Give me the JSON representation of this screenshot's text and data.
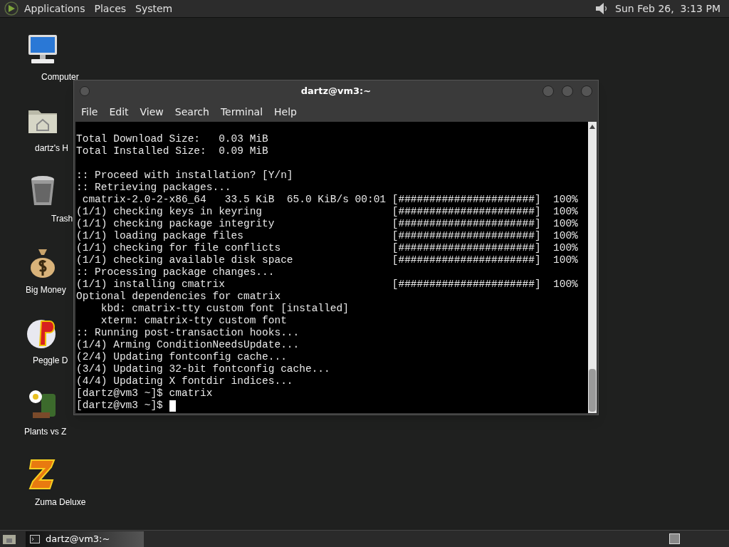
{
  "top_panel": {
    "menus": [
      "Applications",
      "Places",
      "System"
    ],
    "clock": "Sun Feb 26,  3:13 PM"
  },
  "desktop_icons": [
    {
      "kind": "computer",
      "label": "Computer"
    },
    {
      "kind": "home",
      "label": "dartz's H"
    },
    {
      "kind": "trash",
      "label": "Trash"
    },
    {
      "kind": "money",
      "label": "Big Money"
    },
    {
      "kind": "peggle",
      "label": "Peggle D"
    },
    {
      "kind": "plants",
      "label": "Plants vs Z"
    },
    {
      "kind": "zuma",
      "label": "Zuma Deluxe"
    }
  ],
  "window": {
    "title": "dartz@vm3:~",
    "menu": [
      "File",
      "Edit",
      "View",
      "Search",
      "Terminal",
      "Help"
    ],
    "lines": [
      {
        "kind": "text",
        "text": "Total Download Size:   0.03 MiB"
      },
      {
        "kind": "text",
        "text": "Total Installed Size:  0.09 MiB"
      },
      {
        "kind": "blank"
      },
      {
        "kind": "text",
        "text": ":: Proceed with installation? [Y/n]"
      },
      {
        "kind": "text",
        "text": ":: Retrieving packages..."
      },
      {
        "kind": "progress",
        "text": " cmatrix-2.0-2-x86_64   33.5 KiB  65.0 KiB/s 00:01",
        "bar": "[######################]",
        "percent": "100%"
      },
      {
        "kind": "progress",
        "text": "(1/1) checking keys in keyring",
        "bar": "[######################]",
        "percent": "100%"
      },
      {
        "kind": "progress",
        "text": "(1/1) checking package integrity",
        "bar": "[######################]",
        "percent": "100%"
      },
      {
        "kind": "progress",
        "text": "(1/1) loading package files",
        "bar": "[######################]",
        "percent": "100%"
      },
      {
        "kind": "progress",
        "text": "(1/1) checking for file conflicts",
        "bar": "[######################]",
        "percent": "100%"
      },
      {
        "kind": "progress",
        "text": "(1/1) checking available disk space",
        "bar": "[######################]",
        "percent": "100%"
      },
      {
        "kind": "text",
        "text": ":: Processing package changes..."
      },
      {
        "kind": "progress",
        "text": "(1/1) installing cmatrix",
        "bar": "[######################]",
        "percent": "100%"
      },
      {
        "kind": "text",
        "text": "Optional dependencies for cmatrix"
      },
      {
        "kind": "text",
        "text": "    kbd: cmatrix-tty custom font [installed]"
      },
      {
        "kind": "text",
        "text": "    xterm: cmatrix-tty custom font"
      },
      {
        "kind": "text",
        "text": ":: Running post-transaction hooks..."
      },
      {
        "kind": "text",
        "text": "(1/4) Arming ConditionNeedsUpdate..."
      },
      {
        "kind": "text",
        "text": "(2/4) Updating fontconfig cache..."
      },
      {
        "kind": "text",
        "text": "(3/4) Updating 32-bit fontconfig cache..."
      },
      {
        "kind": "text",
        "text": "(4/4) Updating X fontdir indices..."
      },
      {
        "kind": "text",
        "text": "[dartz@vm3 ~]$ cmatrix"
      },
      {
        "kind": "prompt",
        "text": "[dartz@vm3 ~]$ "
      }
    ]
  },
  "taskbar": {
    "tasks": [
      {
        "label": "dartz@vm3:~",
        "selected": true
      }
    ]
  }
}
